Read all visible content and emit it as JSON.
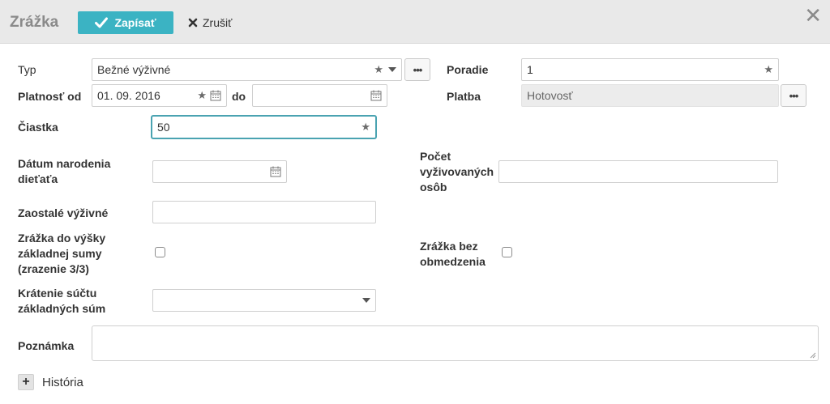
{
  "header": {
    "title": "Zrážka",
    "save_label": "Zapísať",
    "cancel_label": "Zrušiť",
    "close_symbol": "✕"
  },
  "form": {
    "typ": {
      "label": "Typ",
      "value": "Bežné výživné"
    },
    "poradie": {
      "label": "Poradie",
      "value": "1"
    },
    "platnost_od": {
      "label": "Platnosť od",
      "value": "01. 09. 2016"
    },
    "do": {
      "label": "do",
      "value": ""
    },
    "platba": {
      "label": "Platba",
      "value": "Hotovosť"
    },
    "ciastka": {
      "label": "Čiastka",
      "value": "50"
    },
    "datum_narodenia": {
      "label_line1": "Dátum narodenia",
      "label_line2": "dieťaťa",
      "value": ""
    },
    "pocet_vyzivovanych": {
      "label_line1": "Počet",
      "label_line2": "vyživovaných",
      "label_line3": "osôb",
      "value": ""
    },
    "zaostale": {
      "label": "Zaostalé výživné",
      "value": ""
    },
    "zrazka_do_vysky": {
      "label_line1": "Zrážka do výšky",
      "label_line2": "základnej sumy",
      "label_line3": "(zrazenie 3/3)",
      "checked": false
    },
    "zrazka_bez": {
      "label_line1": "Zrážka bez",
      "label_line2": "obmedzenia",
      "checked": false
    },
    "kratenie": {
      "label_line1": "Krátenie súčtu",
      "label_line2": "základných súm",
      "value": ""
    },
    "poznamka": {
      "label": "Poznámka",
      "value": ""
    }
  },
  "history": {
    "label": "História",
    "toggle": "+"
  },
  "icons": {
    "ellipsis": "•••",
    "star": "★"
  },
  "colors": {
    "accent": "#3bb3c3",
    "focus_border": "#4aa3b1",
    "header_bg": "#e9e9e9"
  }
}
